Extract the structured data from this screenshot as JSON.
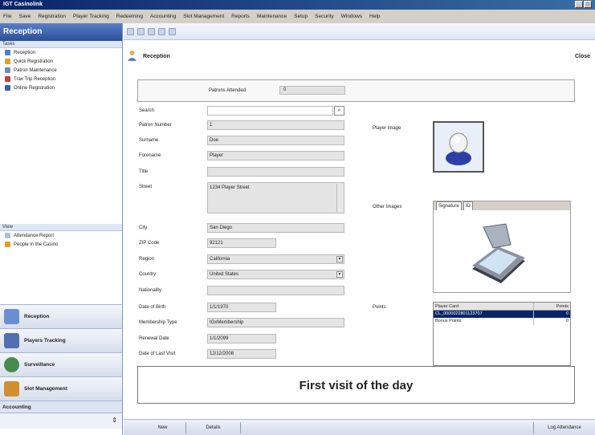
{
  "window": {
    "title": "IGT Casinolink",
    "controls": [
      "_",
      "□"
    ]
  },
  "menu": [
    "File",
    "Save",
    "Registration",
    "Player Tracking",
    "Redeeming",
    "Accounting",
    "Slot Management",
    "Reports",
    "Maintenance",
    "Setup",
    "Security",
    "Windows",
    "Help"
  ],
  "sidebar": {
    "header": "Reception",
    "tasks_title": "Tasks",
    "tasks": [
      {
        "label": "Reception",
        "icon": "person-icon",
        "color": "#4a7fd0"
      },
      {
        "label": "Quick Registration",
        "icon": "pencil-icon",
        "color": "#e0a020"
      },
      {
        "label": "Patron Maintenance",
        "icon": "document-icon",
        "color": "#6a8fc0"
      },
      {
        "label": "Trax Trip Reception",
        "icon": "car-icon",
        "color": "#c04040"
      },
      {
        "label": "Online Registration",
        "icon": "web-icon",
        "color": "#3a60a0"
      }
    ],
    "view_title": "View",
    "view": [
      {
        "label": "Attendance Report",
        "icon": "report-icon",
        "color": "#aac0e0"
      },
      {
        "label": "People in the Casino",
        "icon": "people-icon",
        "color": "#e0a020"
      }
    ],
    "modules": [
      {
        "label": "Reception",
        "icon": "reception-icon",
        "color": "#6a8fd0"
      },
      {
        "label": "Players Tracking",
        "icon": "players-tracking-icon",
        "color": "#5070b0"
      },
      {
        "label": "Surveillance",
        "icon": "surveillance-icon",
        "color": "#4a8a50"
      },
      {
        "label": "Slot Management",
        "icon": "slot-machine-icon",
        "color": "#d09030"
      }
    ],
    "accounting": "Accounting"
  },
  "page": {
    "title": "Reception",
    "close": "Close",
    "patrons_attended_label": "Patrons Attended",
    "patrons_attended_value": "0"
  },
  "form": {
    "search_label": "Search",
    "search_value": "",
    "patron_number_label": "Patron Number",
    "patron_number": "1",
    "surname_label": "Surname",
    "surname": "Doe",
    "forename_label": "Forename",
    "forename": "Player",
    "title_label": "Title",
    "title": "",
    "street_label": "Street",
    "street": "1234 Player Street",
    "city_label": "City",
    "city": "San Diego",
    "zip_label": "ZIP Code",
    "zip": "92121",
    "region_label": "Region",
    "region": "California",
    "country_label": "Country",
    "country": "United States",
    "nationality_label": "Nationality",
    "nationality": "",
    "dob_label": "Date of Birth",
    "dob": "1/1/1970",
    "membership_label": "Membership Type",
    "membership": "IGxMembership",
    "renewal_label": "Renewal Date",
    "renewal": "1/1/2099",
    "lastvisit_label": "Date of Last Visit",
    "lastvisit": "12/12/2008"
  },
  "right": {
    "player_image_label": "Player Image",
    "other_images_label": "Other Images",
    "other_tabs": [
      "Signature",
      "ID"
    ],
    "points_label": "Points",
    "points_columns": [
      "Player Card",
      "Points"
    ],
    "points_rows": [
      {
        "card": "CL_0000022801123707",
        "points": "0",
        "selected": true
      },
      {
        "card": "Bonus Points",
        "points": "0",
        "selected": false
      }
    ]
  },
  "message": "First visit of the day",
  "status": {
    "new": "New",
    "details": "Details",
    "log_attendance": "Log Attendance"
  }
}
